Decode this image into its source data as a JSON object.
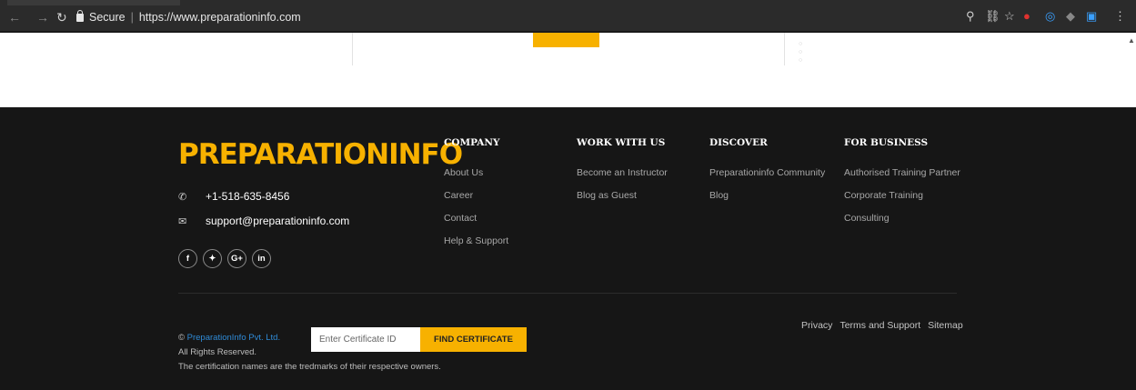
{
  "browser": {
    "secure_label": "Secure",
    "url": "https://www.preparationinfo.com"
  },
  "footer": {
    "logo_text": "PREPARATIONINFO",
    "phone": "+1-518-635-8456",
    "email": "support@preparationinfo.com",
    "social": [
      "f",
      "✦",
      "G+",
      "in"
    ],
    "columns": [
      {
        "heading": "COMPANY",
        "links": [
          "About Us",
          "Career",
          "Contact",
          "Help & Support"
        ]
      },
      {
        "heading": "WORK WITH US",
        "links": [
          "Become an Instructor",
          "Blog as Guest"
        ]
      },
      {
        "heading": "DISCOVER",
        "links": [
          "Preparationinfo Community",
          "Blog"
        ]
      },
      {
        "heading": "FOR BUSINESS",
        "links": [
          "Authorised Training Partner",
          "Corporate Training",
          "Consulting"
        ]
      }
    ],
    "legal_links": [
      "Privacy",
      "Terms and Support",
      "Sitemap"
    ],
    "copyright_brand": "PreparationInfo Pvt. Ltd.",
    "rights": "All Rights Reserved.",
    "trademark_note": "The certification names are the tredmarks of their respective owners.",
    "cert_placeholder": "Enter Certificate ID",
    "cert_button": "FIND CERTIFICATE"
  },
  "colors": {
    "accent": "#f7b100",
    "footer_bg": "#161616",
    "link_blue": "#2f8ad6"
  }
}
